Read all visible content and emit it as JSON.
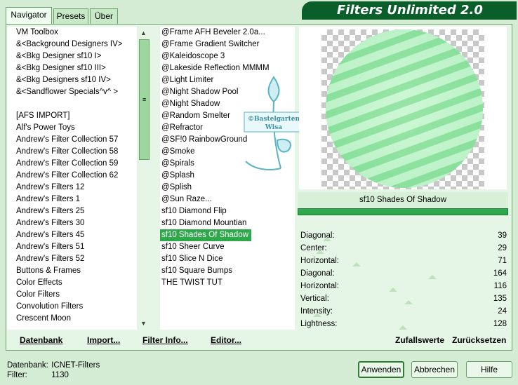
{
  "app": {
    "title": "Filters Unlimited 2.0"
  },
  "tabs": [
    {
      "label": "Navigator"
    },
    {
      "label": "Presets"
    },
    {
      "label": "Über"
    }
  ],
  "categories": [
    "VM Toolbox",
    "&<Background Designers IV>",
    "&<Bkg Designer sf10 I>",
    "&<Bkg Designer sf10 III>",
    "&<Bkg Designers sf10 IV>",
    "&<Sandflower Specials^v^ >",
    "",
    "[AFS IMPORT]",
    "Alf's Power Toys",
    "Andrew's Filter Collection 57",
    "Andrew's Filter Collection 58",
    "Andrew's Filter Collection 59",
    "Andrew's Filter Collection 62",
    "Andrew's Filters 12",
    "Andrew's Filters 1",
    "Andrew's Filters 25",
    "Andrew's Filters 30",
    "Andrew's Filters 45",
    "Andrew's Filters 51",
    "Andrew's Filters 52",
    "Buttons & Frames",
    "Color Effects",
    "Color Filters",
    "Convolution Filters",
    "Crescent Moon"
  ],
  "filters": [
    "@Frame AFH Beveler 2.0a...",
    "@Frame Gradient Switcher",
    "@Kaleidoscope 3",
    "@Lakeside Reflection MMMM",
    "@Light Limiter",
    "@Night Shadow Pool",
    "@Night Shadow",
    "@Random Smelter",
    "@Refractor",
    "@SF!0 RainbowGround",
    "@Smoke",
    "@Spirals",
    "@Splash",
    "@Splish",
    "@Sun Raze...",
    "sf10 Diamond Flip",
    "sf10 Diamond Mountian",
    "sf10 Shades Of Shadow",
    "sf10 Sheer Curve",
    "sf10 Slice N Dice",
    "sf10 Square Bumps",
    "THE TWIST TUT"
  ],
  "selected_filter": "sf10 Shades Of Shadow",
  "watermark": {
    "line1": "©Bastelgarten",
    "line2": "Wisa"
  },
  "params": [
    {
      "label": "Diagonal:",
      "value": "39"
    },
    {
      "label": "Center:",
      "value": "29"
    },
    {
      "label": "Horizontal:",
      "value": "71"
    },
    {
      "label": "Diagonal:",
      "value": "164"
    },
    {
      "label": "Horizontal:",
      "value": "116"
    },
    {
      "label": "Vertical:",
      "value": "135"
    },
    {
      "label": "Intensity:",
      "value": "24"
    },
    {
      "label": "Lightness:",
      "value": "128"
    }
  ],
  "links": {
    "datenbank": "Datenbank",
    "import": "Import...",
    "filter_info": "Filter Info...",
    "editor": "Editor...",
    "zufall": "Zufallswerte",
    "reset": "Zurücksetzen"
  },
  "status": {
    "db_label": "Datenbank:",
    "db_value": "ICNET-Filters",
    "filter_label": "Filter:",
    "filter_value": "1130"
  },
  "buttons": {
    "apply": "Anwenden",
    "cancel": "Abbrechen",
    "help": "Hilfe"
  },
  "colors": {
    "accent": "#2ea84a",
    "title_bg": "#0a5e2a",
    "panel_bg": "#d4ecd4"
  }
}
